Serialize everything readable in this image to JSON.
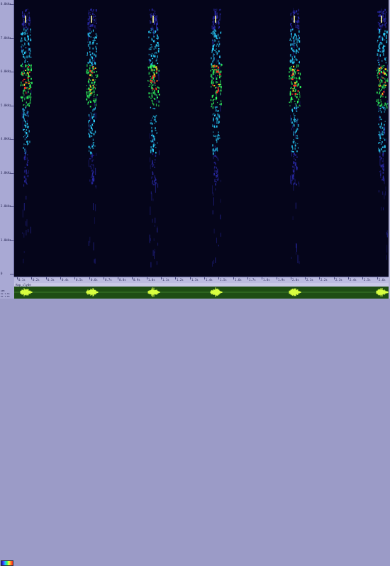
{
  "ruler": {
    "units": "Hz",
    "labels": [
      "8.0kHz",
      "7.0kHz",
      "6.0kHz",
      "5.0kHz",
      "4.0kHz",
      "3.0kHz",
      "2.0kHz",
      "1.0kHz",
      "0"
    ]
  },
  "timeline": {
    "labels": [
      "0.1s",
      "0.2s",
      "0.3s",
      "0.4s",
      "0.5s",
      "0.6s",
      "0.7s",
      "0.8s",
      "0.9s",
      "1.0s",
      "1.1s",
      "1.2s",
      "1.3s",
      "1.4s",
      "1.5s",
      "1.6s",
      "1.7s",
      "1.8s",
      "1.9s",
      "2.0s",
      "2.1s",
      "2.2s",
      "2.3s",
      "2.4s",
      "2.5s",
      "2.6s"
    ]
  },
  "track": {
    "name": "Hap_clyde"
  },
  "corner": {
    "line1": "APR",
    "line2": "ms 1.0s",
    "line3": "ms 1.0s"
  },
  "colors": {
    "background": "#05051a",
    "low": "#2a2aa8",
    "mid": "#2ad0ff",
    "high": "#30ff60",
    "peak": "#ff3020",
    "waveform_bg": "#1e4d14",
    "waveform_line": "#d8ff40"
  },
  "spectrogram": {
    "calls": [
      {
        "center": 0.031
      },
      {
        "center": 0.206
      },
      {
        "center": 0.371
      },
      {
        "center": 0.538
      },
      {
        "center": 0.748
      },
      {
        "center": 0.981
      }
    ]
  }
}
